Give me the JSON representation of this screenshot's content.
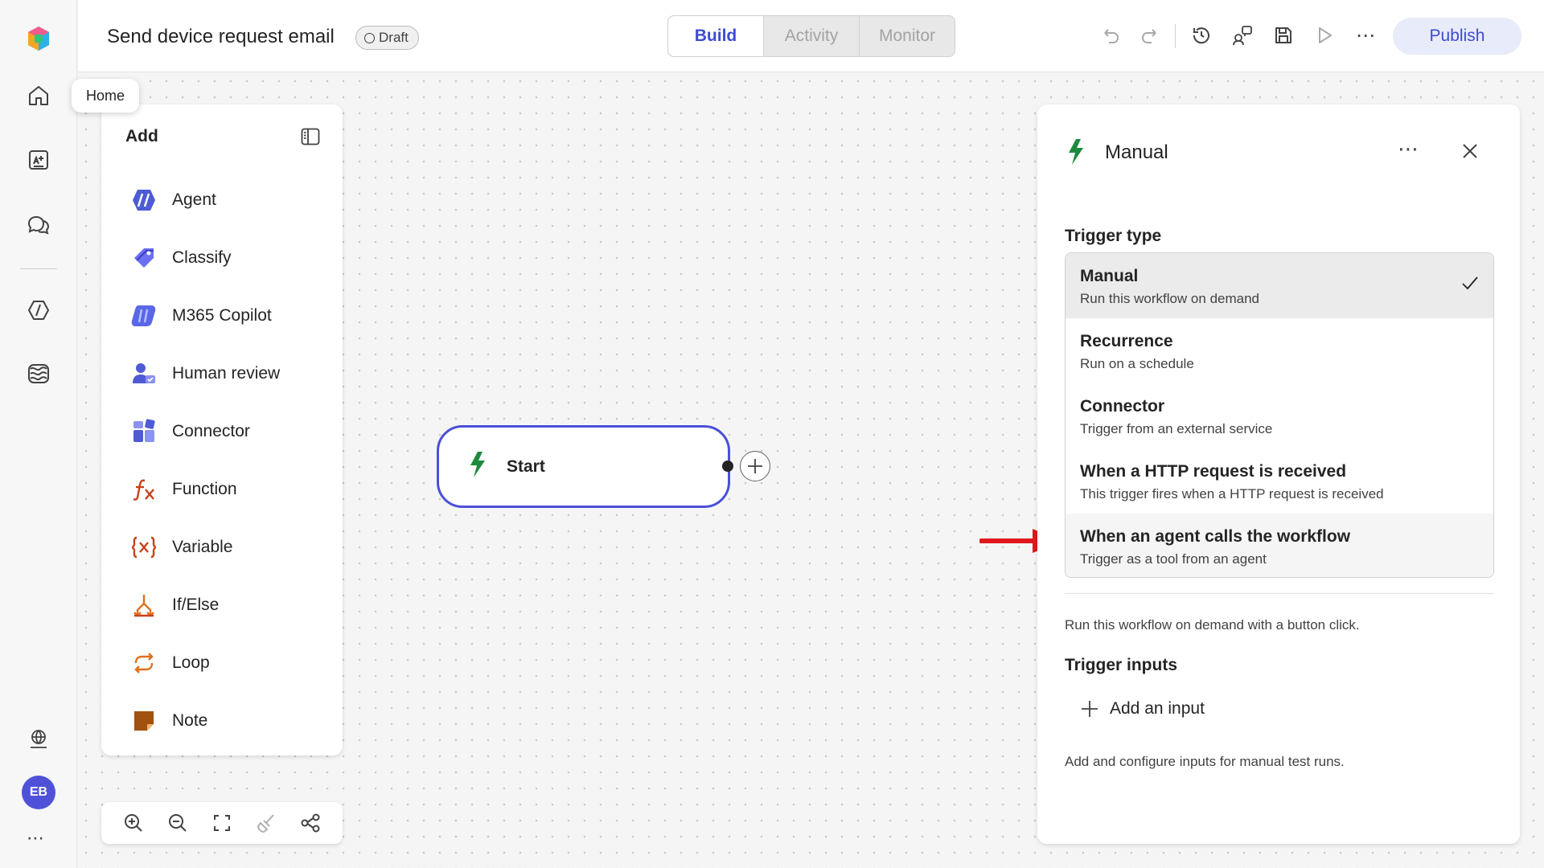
{
  "header": {
    "title": "Send device request email",
    "status_badge": "Draft",
    "tabs": [
      {
        "label": "Build",
        "active": true
      },
      {
        "label": "Activity",
        "active": false
      },
      {
        "label": "Monitor",
        "active": false
      }
    ],
    "publish_label": "Publish",
    "icons": [
      "undo-icon",
      "redo-icon",
      "history-icon",
      "share-icon",
      "save-icon",
      "run-icon",
      "more-icon"
    ]
  },
  "rail": {
    "tooltip": "Home",
    "icons": [
      "app-logo-icon",
      "home-icon",
      "create-icon",
      "chat-icon",
      "agents-icon",
      "knowledge-icon",
      "globe-icon"
    ],
    "avatar_initials": "EB"
  },
  "add_panel": {
    "title": "Add",
    "items": [
      {
        "label": "Agent",
        "icon": "agent-icon"
      },
      {
        "label": "Classify",
        "icon": "classify-icon"
      },
      {
        "label": "M365 Copilot",
        "icon": "copilot-icon"
      },
      {
        "label": "Human review",
        "icon": "human-review-icon"
      },
      {
        "label": "Connector",
        "icon": "connector-icon"
      },
      {
        "label": "Function",
        "icon": "function-icon"
      },
      {
        "label": "Variable",
        "icon": "variable-icon"
      },
      {
        "label": "If/Else",
        "icon": "if-else-icon"
      },
      {
        "label": "Loop",
        "icon": "loop-icon"
      },
      {
        "label": "Note",
        "icon": "note-icon"
      }
    ]
  },
  "canvas": {
    "start_node_label": "Start"
  },
  "trigger_panel": {
    "title": "Manual",
    "trigger_type_label": "Trigger type",
    "options": [
      {
        "title": "Manual",
        "desc": "Run this workflow on demand",
        "selected": true
      },
      {
        "title": "Recurrence",
        "desc": "Run on a schedule",
        "selected": false
      },
      {
        "title": "Connector",
        "desc": "Trigger from an external service",
        "selected": false
      },
      {
        "title": "When a HTTP request is received",
        "desc": "This trigger fires when a HTTP request is received",
        "selected": false
      },
      {
        "title": "When an agent calls the workflow",
        "desc": "Trigger as a tool from an agent",
        "selected": false
      }
    ],
    "description": "Run this workflow on demand with a button click.",
    "trigger_inputs_label": "Trigger inputs",
    "add_input_label": "Add an input",
    "inputs_help": "Add and configure inputs for manual test runs."
  },
  "colors": {
    "accent": "#3d4bd0",
    "node_border": "#4a50d6",
    "trigger_green": "#1e8a3e",
    "arrow_red": "#e0181e"
  }
}
